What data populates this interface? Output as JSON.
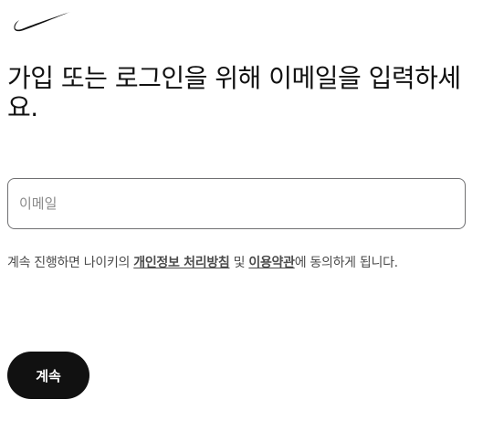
{
  "brand": {
    "logo_icon": "nike-swoosh-icon",
    "logo_color": "#111111"
  },
  "heading": "가입 또는 로그인을 위해 이메일을 입력하세요.",
  "email": {
    "placeholder": "이메일",
    "value": ""
  },
  "terms": {
    "prefix": "계속 진행하면 나이키의 ",
    "privacy_link": "개인정보 처리방침",
    "and": " 및 ",
    "terms_link": "이용약관",
    "suffix": "에 동의하게 됩니다."
  },
  "continue_button": {
    "label": "계속",
    "background": "#111111",
    "color": "#ffffff"
  }
}
